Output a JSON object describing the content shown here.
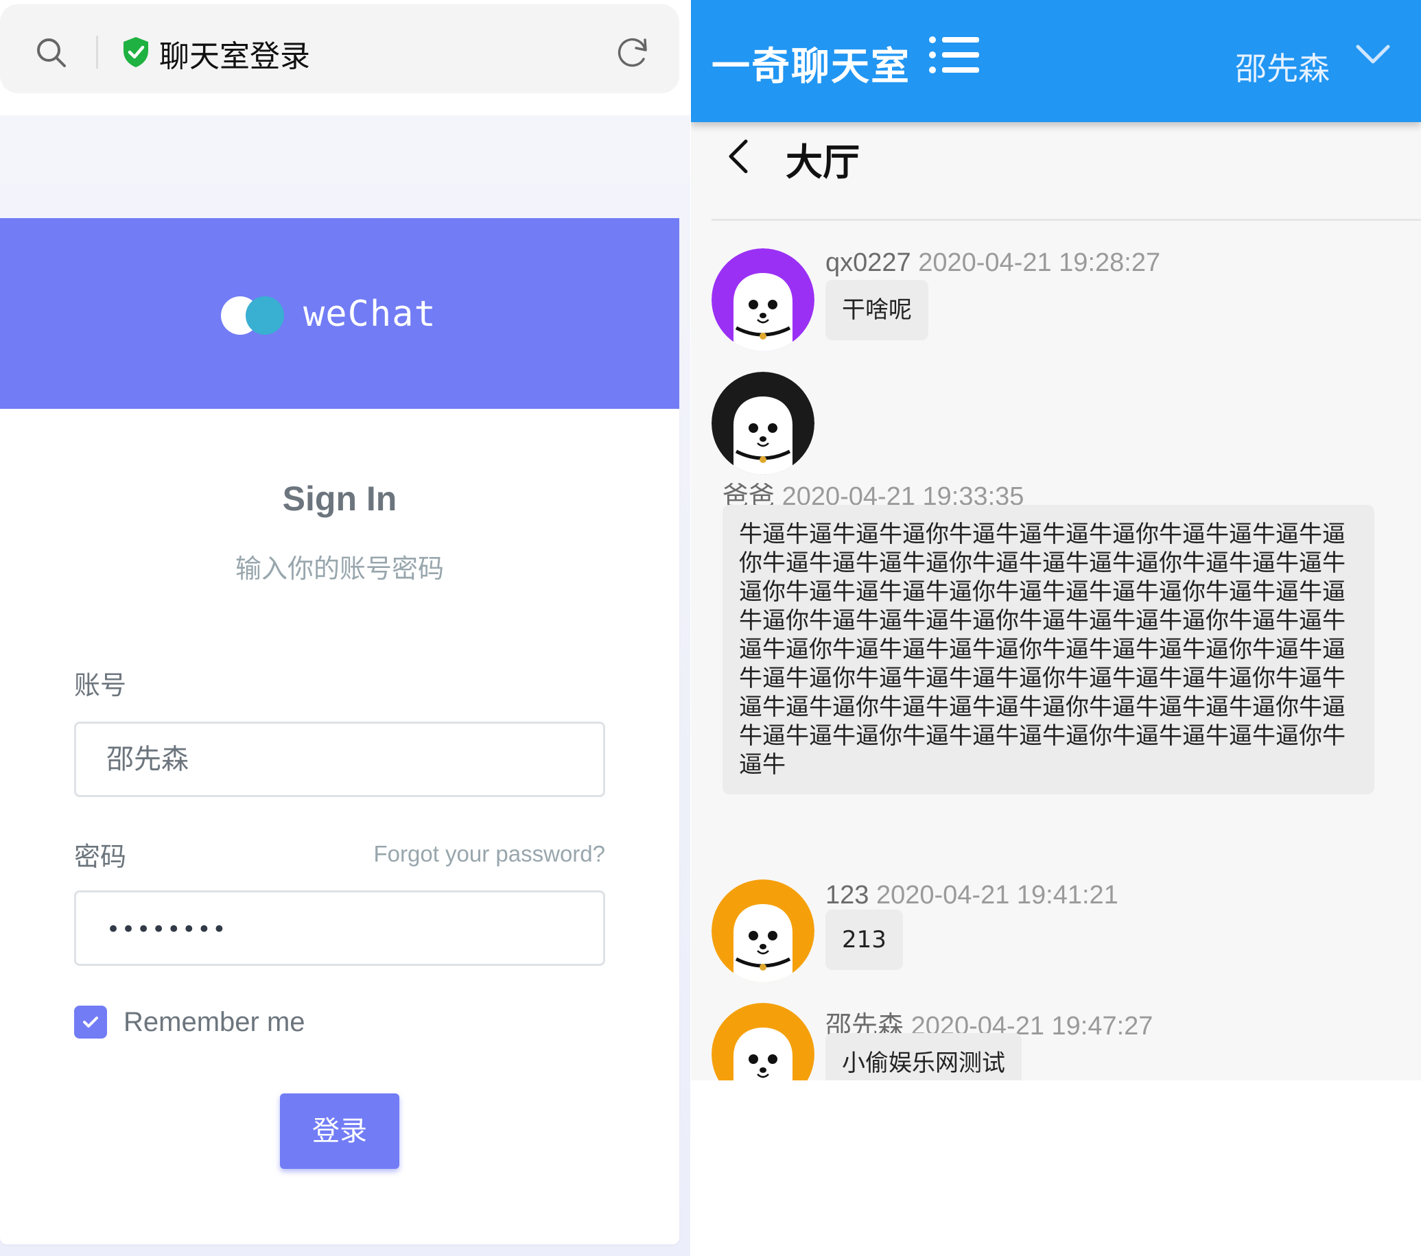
{
  "browser": {
    "page_title": "聊天室登录",
    "icons": {
      "search": "search-icon",
      "secure": "shield-check-icon",
      "reload": "reload-icon"
    }
  },
  "login": {
    "brand": "weChat",
    "title": "Sign In",
    "subtitle": "输入你的账号密码",
    "account_label": "账号",
    "account_value": "邵先森",
    "password_label": "密码",
    "forgot_link": "Forgot your password?",
    "password_mask": "••••••••",
    "remember_label": "Remember me",
    "remember_checked": true,
    "submit_label": "登录",
    "colors": {
      "primary": "#727cf5",
      "accent": "#39afd1"
    }
  },
  "chat": {
    "app_title": "一奇聊天室",
    "current_user": "邵先森",
    "room_title": "大厅",
    "colors": {
      "topbar": "#2196f3"
    },
    "messages": [
      {
        "user": "qx0227",
        "time": "2020-04-21 19:28:27",
        "text": "干啥呢",
        "avatar_color": "#9b30f5"
      },
      {
        "user": "爸爸",
        "time": "2020-04-21 19:33:35",
        "text": "牛逼牛逼牛逼牛逼你牛逼牛逼牛逼牛逼你牛逼牛逼牛逼牛逼你牛逼牛逼牛逼牛逼你牛逼牛逼牛逼牛逼你牛逼牛逼牛逼牛逼你牛逼牛逼牛逼牛逼你牛逼牛逼牛逼牛逼你牛逼牛逼牛逼牛逼你牛逼牛逼牛逼牛逼你牛逼牛逼牛逼牛逼你牛逼牛逼牛逼牛逼你牛逼牛逼牛逼牛逼你牛逼牛逼牛逼牛逼你牛逼牛逼牛逼牛逼你牛逼牛逼牛逼牛逼你牛逼牛逼牛逼牛逼你牛逼牛逼牛逼牛逼你牛逼牛逼牛逼牛逼你牛逼牛逼牛逼牛逼你牛逼牛逼牛逼牛逼你牛逼牛逼牛逼牛逼你牛逼牛逼牛逼牛逼你牛逼牛",
        "avatar_color": "#1a1a1a"
      },
      {
        "user": "123",
        "time": "2020-04-21 19:41:21",
        "text": "213",
        "avatar_color": "#f5a00b"
      },
      {
        "user": "邵先森",
        "time": "2020-04-21 19:47:27",
        "text": "小偷娱乐网测试",
        "avatar_color": "#f5a00b"
      }
    ]
  }
}
